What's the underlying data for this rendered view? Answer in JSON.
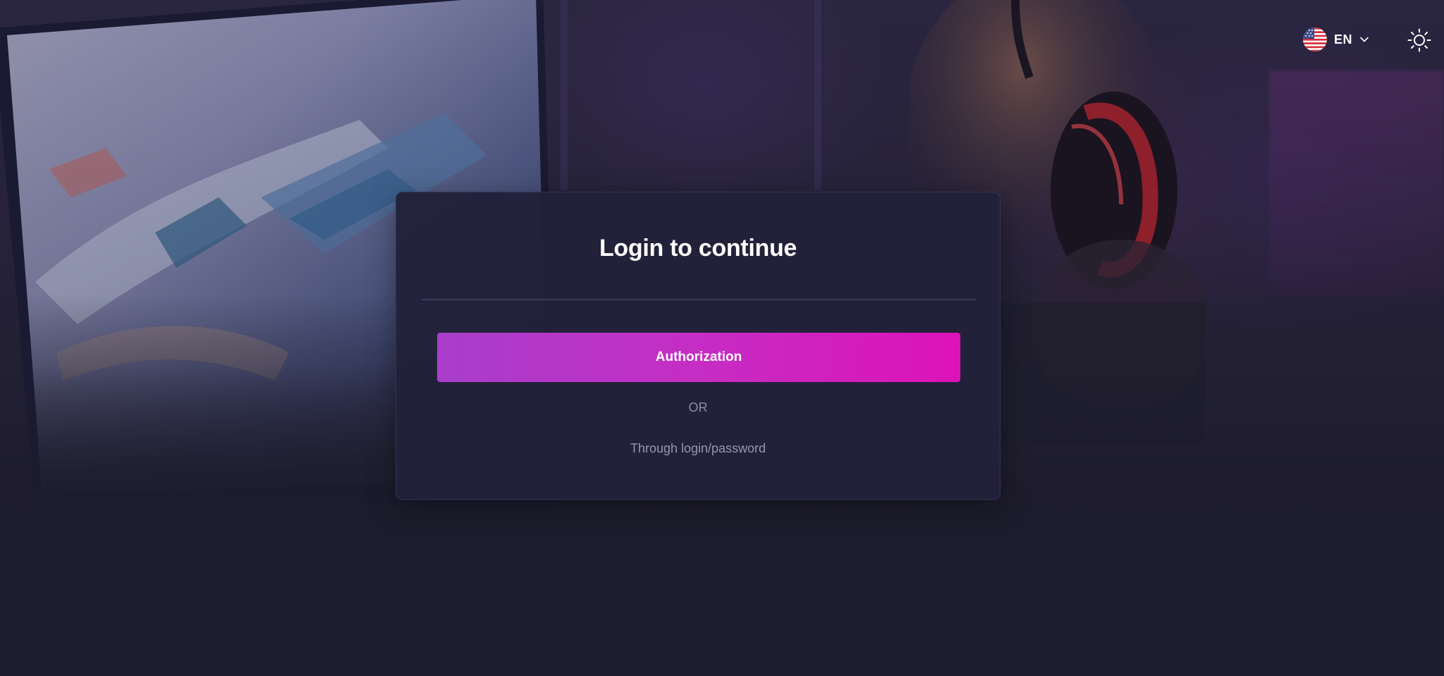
{
  "header": {
    "language": {
      "code": "EN",
      "flag_icon": "us-flag-icon",
      "dropdown_icon": "chevron-down-icon"
    },
    "theme_toggle": {
      "icon": "sun-icon"
    }
  },
  "login_card": {
    "title": "Login to continue",
    "authorization_button_label": "Authorization",
    "separator_text": "OR",
    "alternative_login_link": "Through login/password"
  },
  "colors": {
    "page_background": "#1d1c2c",
    "card_background": "#22213a",
    "button_gradient_start": "#a83ecb",
    "button_gradient_end": "#dd12b8",
    "muted_text": "#8e8cae"
  }
}
